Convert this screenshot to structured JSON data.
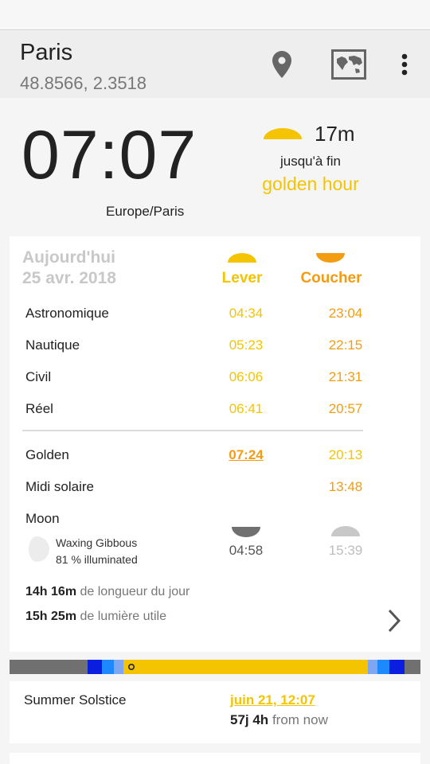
{
  "location": {
    "city": "Paris",
    "coords": "48.8566, 2.3518"
  },
  "icons": {
    "location": "map-pin-icon",
    "map": "world-map-icon",
    "more": "more-vert-icon"
  },
  "clock": {
    "time": "07:07",
    "timezone": "Europe/Paris"
  },
  "golden_countdown": {
    "remaining": "17m",
    "until": "jusqu'à fin",
    "label": "golden hour"
  },
  "day": {
    "line1": "Aujourd'hui",
    "line2": "25 avr. 2018"
  },
  "columns": {
    "rise": "Lever",
    "set": "Coucher"
  },
  "twilight": [
    {
      "label": "Astronomique",
      "rise": "04:34",
      "set": "23:04"
    },
    {
      "label": "Nautique",
      "rise": "05:23",
      "set": "22:15"
    },
    {
      "label": "Civil",
      "rise": "06:06",
      "set": "21:31"
    },
    {
      "label": "Réel",
      "rise": "06:41",
      "set": "20:57"
    }
  ],
  "golden": {
    "label": "Golden",
    "rise": "07:24",
    "set": "20:13"
  },
  "noon": {
    "label": "Midi solaire",
    "time": "13:48"
  },
  "moon": {
    "label": "Moon",
    "phase": "Waxing Gibbous",
    "illumination": "81 % illuminated",
    "rise": "04:58",
    "set": "15:39"
  },
  "day_length": {
    "value": "14h 16m",
    "text": "de longueur du jour"
  },
  "light_length": {
    "value": "15h 25m",
    "text": "de lumière utile"
  },
  "colors": {
    "golden": "#f5c400",
    "sunset": "#f39c12",
    "night": "#707070",
    "astro": "#0a1ee0",
    "nautical": "#1e88ff",
    "civil": "#7fa6f2"
  },
  "solstice": {
    "label": "Summer Solstice",
    "date": "juin 21, 12:07",
    "countdown": "57j 4h",
    "suffix": "from now"
  }
}
